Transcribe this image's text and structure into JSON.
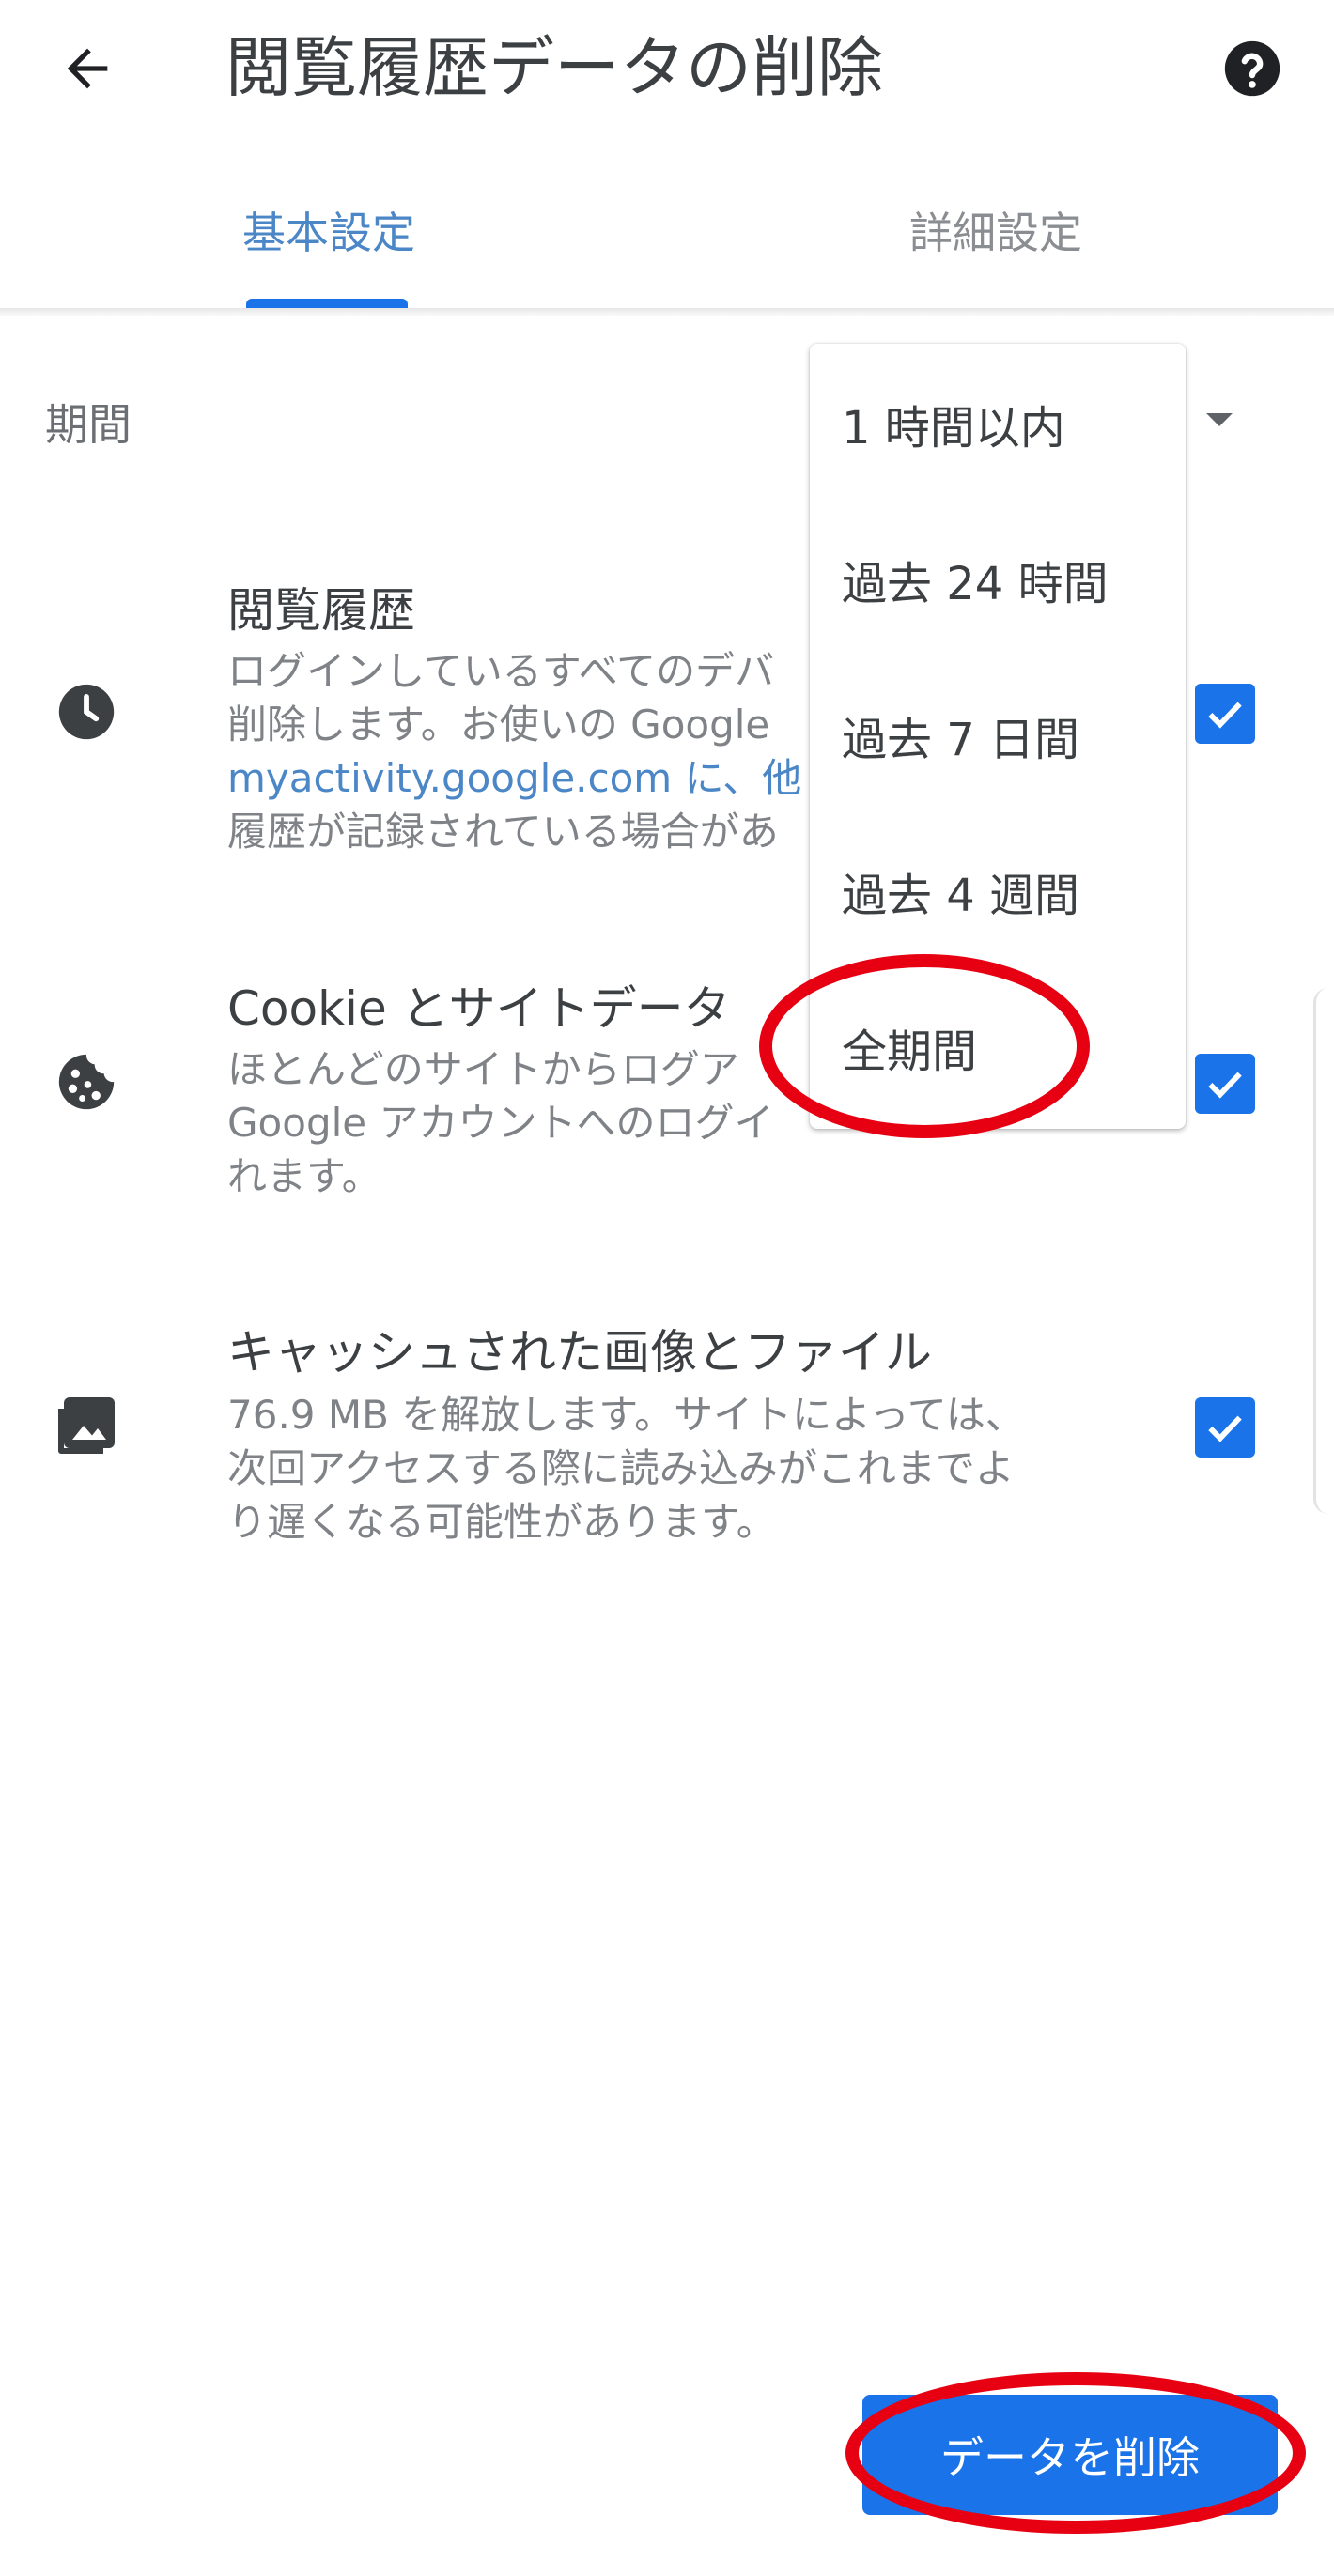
{
  "header": {
    "back_icon": "arrow-left-icon",
    "title": "閲覧履歴データの削除",
    "help_icon": "help-circle-icon"
  },
  "tabs": [
    {
      "label": "基本設定",
      "selected": true
    },
    {
      "label": "詳細設定",
      "selected": false
    }
  ],
  "time_range": {
    "label": "期間"
  },
  "items": [
    {
      "icon": "clock-icon",
      "title": "閲覧履歴",
      "desc_lines": [
        "ログインしているすべてのデバ",
        "削除します。お使いの Google",
        "myactivity.google.com に、他",
        "履歴が記録されている場合があ"
      ],
      "checked": true
    },
    {
      "icon": "cookie-icon",
      "title": "Cookie とサイトデータ",
      "desc_lines": [
        "ほとんどのサイトからログア",
        "Google アカウントへのログイ",
        "れます。"
      ],
      "checked": true
    },
    {
      "icon": "images-icon",
      "title": "キャッシュされた画像とファイル",
      "desc_lines": [
        "76.9 MB を解放します。サイトによっては、",
        "次回アクセスする際に読み込みがこれまでよ",
        "り遅くなる可能性があります。"
      ],
      "checked": true
    }
  ],
  "menu": {
    "options": [
      "1 時間以内",
      "過去 24 時間",
      "過去 7 日間",
      "過去 4 週間",
      "全期間"
    ]
  },
  "delete_button": {
    "label": "データを削除"
  },
  "colors": {
    "accent": "#1a73e8",
    "annotation": "#e60012"
  }
}
